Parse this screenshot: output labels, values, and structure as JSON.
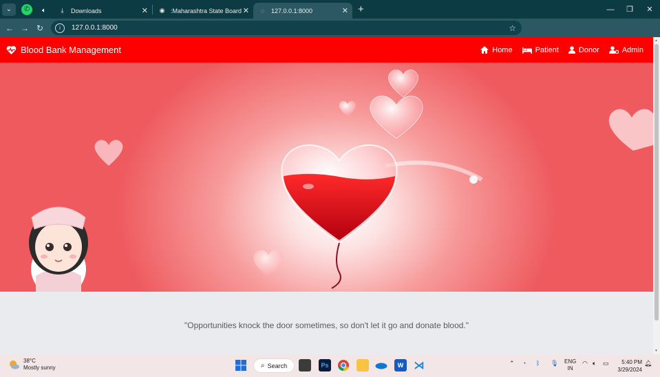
{
  "browser": {
    "tabs": [
      {
        "label": "Downloads",
        "icon": "download-icon",
        "active": false
      },
      {
        "label": ":Maharashtra State Board of Te",
        "icon": "globe-icon",
        "active": false
      },
      {
        "label": "127.0.0.1:8000",
        "icon": "globe-icon",
        "active": true
      }
    ],
    "url": "127.0.0.1:8000"
  },
  "navbar": {
    "brand": "Blood Bank Management",
    "links": [
      {
        "label": "Home",
        "icon": "home-icon"
      },
      {
        "label": "Patient",
        "icon": "bed-icon"
      },
      {
        "label": "Donor",
        "icon": "user-icon"
      },
      {
        "label": "Admin",
        "icon": "user-cog-icon"
      }
    ],
    "color": "#ff0000"
  },
  "hero": {
    "accent": "#ee5a5e"
  },
  "quote": "\"Opportunities knock the door sometimes, so don't let it go and donate blood.\"",
  "taskbar": {
    "weather": {
      "temp": "38°C",
      "desc": "Mostly sunny"
    },
    "search_label": "Search",
    "lang": "ENG",
    "region": "IN",
    "time": "5:40 PM",
    "date": "3/29/2024"
  }
}
